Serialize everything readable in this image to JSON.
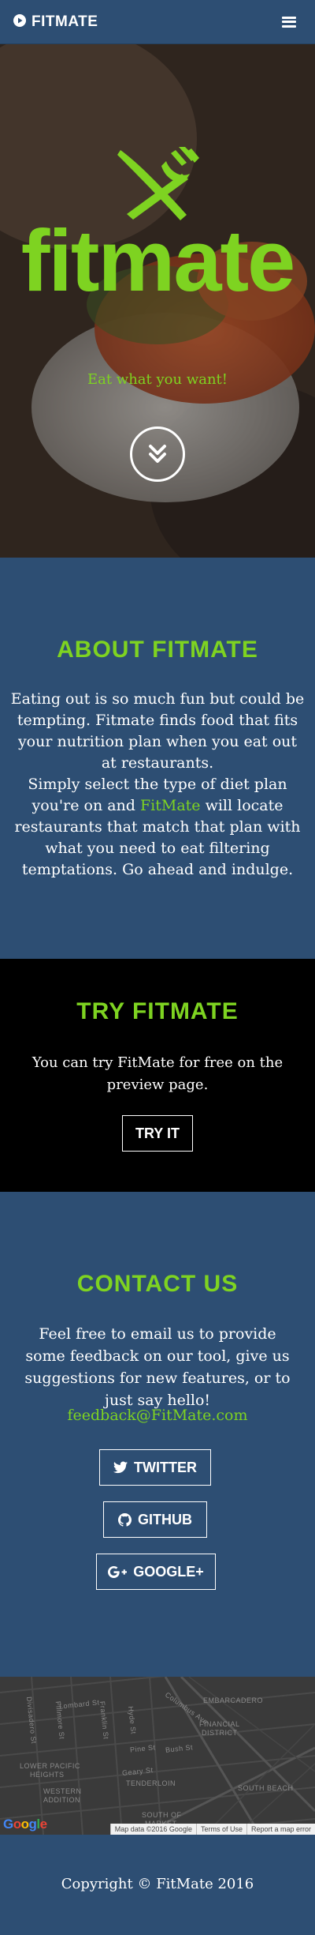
{
  "navbar": {
    "brand": "FITMATE",
    "brand_icon": "play-circle-icon",
    "menu_icon": "hamburger-icon"
  },
  "hero": {
    "logo_icon": "fork-knife-icon",
    "wordmark": "fitmate",
    "tagline": "Eat what you want!",
    "scroll_icon": "double-chevron-down-icon"
  },
  "about": {
    "heading": "ABOUT FITMATE",
    "paragraph_1": "Eating out is so much fun but could be tempting. Fitmate finds food that fits your nutrition plan when you eat out at restaurants.",
    "paragraph_2_before": "Simply select the type of diet plan you're on and ",
    "paragraph_2_highlight": "FitMate",
    "paragraph_2_after": " will locate restaurants that match that plan with what you need to eat filtering temptations. Go ahead and indulge."
  },
  "try": {
    "heading": "TRY FITMATE",
    "text": "You can try FitMate for free on the preview page.",
    "button": "TRY IT"
  },
  "contact": {
    "heading": "CONTACT US",
    "text": "Feel free to email us to provide some feedback on our tool, give us suggestions for new features, or to just say hello!",
    "email": "feedback@FitMate.com",
    "twitter": "TWITTER",
    "github": "GITHUB",
    "google": "GOOGLE+"
  },
  "map": {
    "labels": {
      "lombard": "Lombard St",
      "columbus": "Columbus Ave",
      "embarcadero": "EMBARCADERO",
      "financial": "FINANCIAL",
      "district": "DISTRICT",
      "lower_pacific": "LOWER PACIFIC",
      "heights": "HEIGHTS",
      "western": "WESTERN",
      "addition": "ADDITION",
      "tenderloin": "TENDERLOIN",
      "south_beach": "SOUTH BEACH",
      "south_of": "SOUTH OF",
      "market": "MARKET",
      "geary": "Geary St",
      "pine": "Pine St",
      "bush": "Bush St",
      "hyde": "Hyde St",
      "franklin": "Franklin St",
      "fillmore": "Fillmore St",
      "divisadero": "Divisadero St"
    },
    "google": "Google",
    "footer_data": "Map data ©2016 Google",
    "footer_terms": "Terms of Use",
    "footer_report": "Report a map error"
  },
  "footer": {
    "text": "Copyright © FitMate 2016"
  },
  "colors": {
    "brand_green": "#7ed321",
    "navy": "#2d4e73",
    "black": "#000000"
  }
}
